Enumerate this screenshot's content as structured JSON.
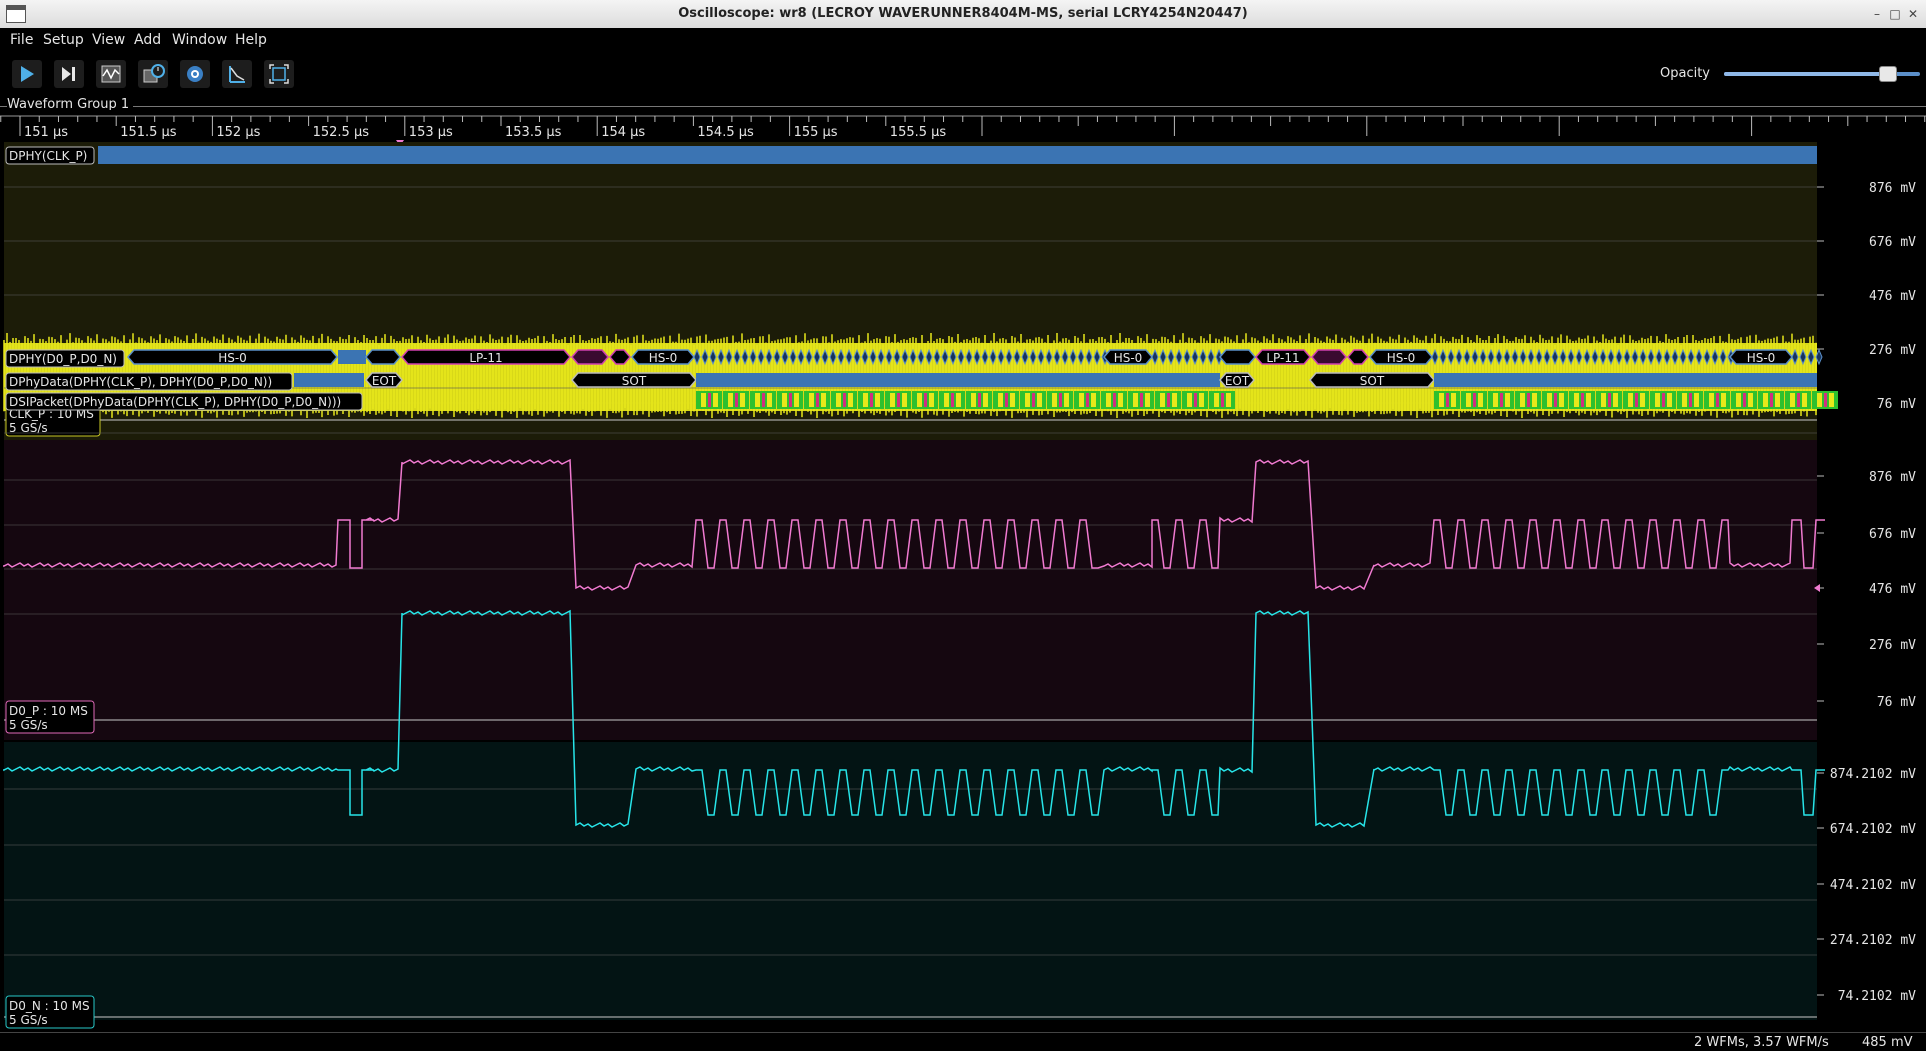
{
  "window": {
    "title": "Oscilloscope: wr8 (LECROY WAVERUNNER8404M-MS, serial LCRY4254N20447)"
  },
  "menu": [
    "File",
    "Setup",
    "View",
    "Add",
    "Window",
    "Help"
  ],
  "toolbar": {
    "buttons": [
      "play-icon",
      "single-step-icon",
      "waveform-icon",
      "history-icon",
      "center-icon",
      "fft-icon",
      "fullscreen-icon"
    ],
    "opacity_label": "Opacity",
    "opacity_value": 0.83
  },
  "group": {
    "name": "Waveform Group 1"
  },
  "timeline": {
    "ticks": [
      "151 µs",
      "151.5 µs",
      "152 µs",
      "152.5 µs",
      "153 µs",
      "153.5 µs",
      "154 µs",
      "154.5 µs",
      "155 µs",
      "155.5 µs"
    ]
  },
  "channels": {
    "clk_p": {
      "protocol_label": "DPHY(CLK_P)",
      "info_line1": "CLK_P : 10 MS",
      "info_line2": "5 GS/s",
      "trace_color": "#e8e81a",
      "y_ticks": [
        "876 mV",
        "676 mV",
        "476 mV",
        "276 mV",
        "76 mV"
      ]
    },
    "d0_p": {
      "protocol_labels": [
        "DPHY(D0_P,D0_N)",
        "DPhyData(DPHY(CLK_P), DPHY(D0_P,D0_N))",
        "DSIPacket(DPhyData(DPHY(CLK_P), DPHY(D0_P,D0_N)))"
      ],
      "states_row1": [
        "HS-0",
        "LP-11",
        "HS-0",
        "HS-0",
        "LP-11",
        "HS-0",
        "HS-0"
      ],
      "states_row2": [
        "EOT",
        "SOT",
        "EOT",
        "SOT"
      ],
      "info_line1": "D0_P : 10 MS",
      "info_line2": "5 GS/s",
      "trace_color": "#f07ad0",
      "y_ticks": [
        "876 mV",
        "676 mV",
        "476 mV",
        "276 mV",
        "76 mV"
      ]
    },
    "d0_n": {
      "info_line1": "D0_N : 10 MS",
      "info_line2": "5 GS/s",
      "trace_color": "#27e4e8",
      "y_ticks": [
        "874.2102 mV",
        "674.2102 mV",
        "474.2102 mV",
        "274.2102 mV",
        "74.2102 mV"
      ]
    }
  },
  "status": {
    "rate": "2 WFMs, 3.57 WFM/s",
    "cursor": "485 mV"
  }
}
